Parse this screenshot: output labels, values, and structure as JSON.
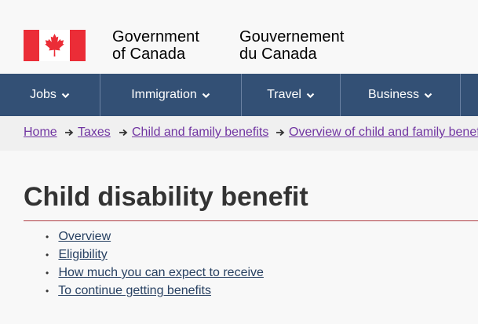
{
  "header": {
    "signature_en_line1": "Government",
    "signature_en_line2": "of Canada",
    "signature_fr_line1": "Gouvernement",
    "signature_fr_line2": "du Canada",
    "flag_icon": "canada-flag-icon",
    "flag_colors": {
      "red": "#eb2d37",
      "white": "#ffffff"
    }
  },
  "menu": {
    "background": "#335075",
    "items": [
      {
        "label": "Jobs",
        "icon": "chevron-down-icon"
      },
      {
        "label": "Immigration",
        "icon": "chevron-down-icon"
      },
      {
        "label": "Travel",
        "icon": "chevron-down-icon"
      },
      {
        "label": "Business",
        "icon": "chevron-down-icon"
      }
    ]
  },
  "breadcrumb": {
    "items": [
      {
        "label": "Home"
      },
      {
        "label": "Taxes"
      },
      {
        "label": "Child and family benefits"
      },
      {
        "label": "Overview of child and family benefits"
      }
    ],
    "separator_icon": "arrow-right-icon",
    "link_color": "#7034a1"
  },
  "main": {
    "title": "Child disability benefit",
    "title_rule_color": "#af3c43",
    "toc": [
      {
        "label": "Overview"
      },
      {
        "label": "Eligibility"
      },
      {
        "label": "How much you can expect to receive"
      },
      {
        "label": "To continue getting benefits"
      }
    ],
    "link_color": "#284162"
  }
}
